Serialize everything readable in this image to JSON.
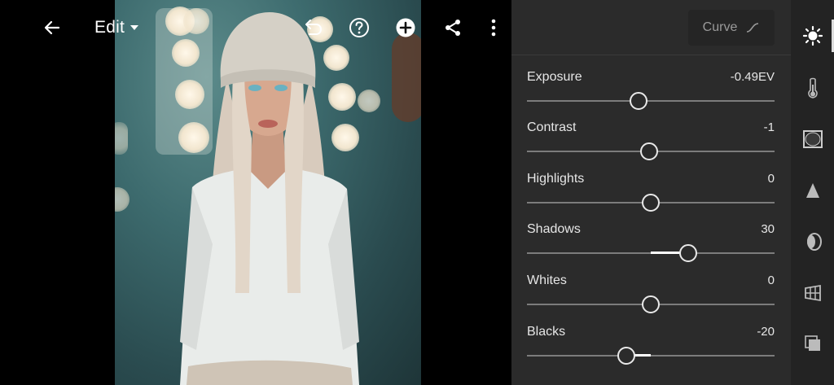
{
  "toolbar": {
    "edit_label": "Edit"
  },
  "panel": {
    "curve_label": "Curve",
    "sliders": [
      {
        "label": "Exposure",
        "value": "-0.49EV",
        "level": 0.45,
        "fill_from": null,
        "fill_to": null
      },
      {
        "label": "Contrast",
        "value": "-1",
        "level": 0.495,
        "fill_from": null,
        "fill_to": null
      },
      {
        "label": "Highlights",
        "value": "0",
        "level": 0.5,
        "fill_from": null,
        "fill_to": null
      },
      {
        "label": "Shadows",
        "value": "30",
        "level": 0.65,
        "fill_from": 0.5,
        "fill_to": 0.65
      },
      {
        "label": "Whites",
        "value": "0",
        "level": 0.5,
        "fill_from": null,
        "fill_to": null
      },
      {
        "label": "Blacks",
        "value": "-20",
        "level": 0.4,
        "fill_from": 0.4,
        "fill_to": 0.5
      }
    ]
  },
  "rail": {
    "items": [
      "light-icon",
      "color-icon",
      "vignette-icon",
      "detail-icon",
      "optics-icon",
      "geometry-icon",
      "presets-icon"
    ]
  },
  "colors": {
    "panel_bg": "#2b2b2b",
    "rail_bg": "#232323",
    "track": "#7c7c7c",
    "thumb": "#e8e8e8"
  }
}
